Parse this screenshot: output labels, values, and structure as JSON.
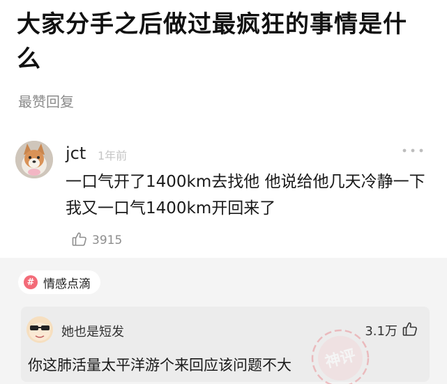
{
  "question": {
    "title": "大家分手之后做过最疯狂的事情是什么"
  },
  "answers_section": {
    "label": "最赞回复"
  },
  "answer": {
    "author": "jct",
    "time": "1年前",
    "text": "一口气开了1400km去找他 他说给他几天冷静一下 我又一口气1400km开回来了",
    "likes": "3915",
    "more_icon": "more-dots-icon",
    "like_icon": "thumbs-up-icon"
  },
  "topic_tag": {
    "icon": "hashtag-icon",
    "label": "情感点滴"
  },
  "hot_comment": {
    "author": "她也是短发",
    "likes": "3.1万",
    "text": "你这肺活量太平洋游个来回应该问题不大",
    "stamp_text": "神评",
    "like_icon": "thumbs-up-icon"
  },
  "colors": {
    "tag_accent": "#f36b78",
    "stamp": "#e98a8f"
  }
}
